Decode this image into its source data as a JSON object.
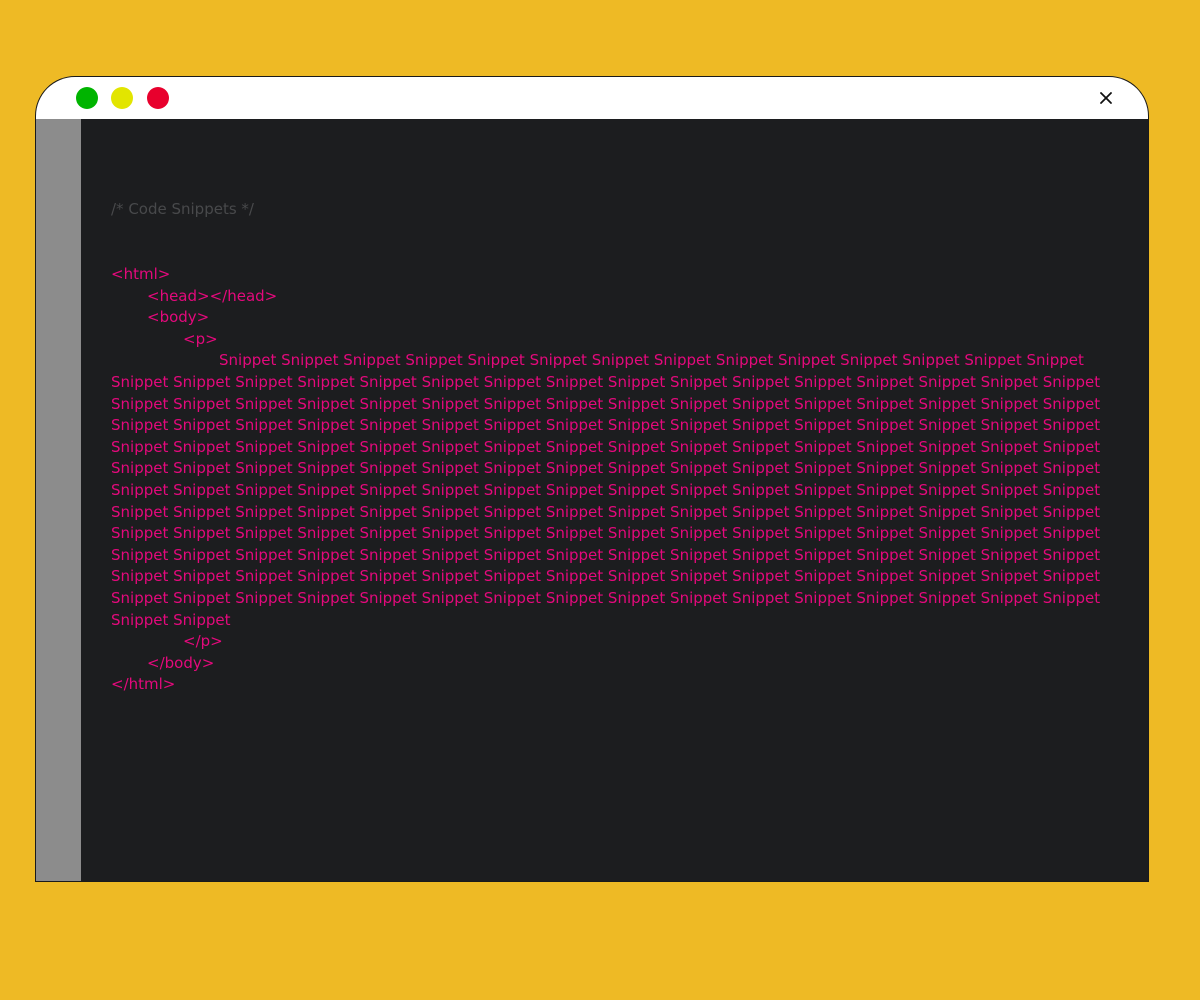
{
  "window": {
    "colors": {
      "background": "#EEBA25",
      "editor": "#1C1D1F",
      "gutter": "#8C8C8C",
      "titlebar": "#FFFFFF",
      "code": "#E4097C",
      "comment": "#48494B",
      "dot_green": "#00B400",
      "dot_yellow": "#E2E500",
      "dot_red": "#E8002D"
    },
    "icons": [
      "close-icon"
    ]
  },
  "editor": {
    "comment": "/* Code Snippets */",
    "lines": {
      "html_open": "<html>",
      "head": "<head></head>",
      "body_open": "<body>",
      "p_open": "<p>",
      "p_close": "</p>",
      "body_close": "</body>",
      "html_close": "</html>"
    },
    "paragraph": {
      "first_line": "Snippet Snippet Snippet Snippet Snippet Snippet Snippet Snippet Snippet Snippet Snippet Snippet Snippet Snippet",
      "middle_lines": [
        "Snippet Snippet Snippet Snippet Snippet Snippet Snippet Snippet Snippet Snippet Snippet Snippet Snippet Snippet Snippet Snippet",
        "Snippet Snippet Snippet Snippet Snippet Snippet Snippet Snippet Snippet Snippet Snippet Snippet Snippet Snippet Snippet Snippet",
        "Snippet Snippet Snippet Snippet Snippet Snippet Snippet Snippet Snippet Snippet Snippet Snippet Snippet Snippet Snippet Snippet",
        "Snippet Snippet Snippet Snippet Snippet Snippet Snippet Snippet Snippet Snippet Snippet Snippet Snippet Snippet Snippet Snippet",
        "Snippet Snippet Snippet Snippet Snippet Snippet Snippet Snippet Snippet Snippet Snippet Snippet Snippet Snippet Snippet Snippet",
        "Snippet Snippet Snippet Snippet Snippet Snippet Snippet Snippet Snippet Snippet Snippet Snippet Snippet Snippet Snippet Snippet",
        "Snippet Snippet Snippet Snippet Snippet Snippet Snippet Snippet Snippet Snippet Snippet Snippet Snippet Snippet Snippet Snippet",
        "Snippet Snippet Snippet Snippet Snippet Snippet Snippet Snippet Snippet Snippet Snippet Snippet Snippet Snippet Snippet Snippet",
        "Snippet Snippet Snippet Snippet Snippet Snippet Snippet Snippet Snippet Snippet Snippet Snippet Snippet Snippet Snippet Snippet",
        "Snippet Snippet Snippet Snippet Snippet Snippet Snippet Snippet Snippet Snippet Snippet Snippet Snippet Snippet Snippet Snippet",
        "Snippet Snippet Snippet Snippet Snippet Snippet Snippet Snippet Snippet Snippet Snippet Snippet Snippet Snippet Snippet Snippet"
      ],
      "last_line": "Snippet Snippet"
    }
  }
}
